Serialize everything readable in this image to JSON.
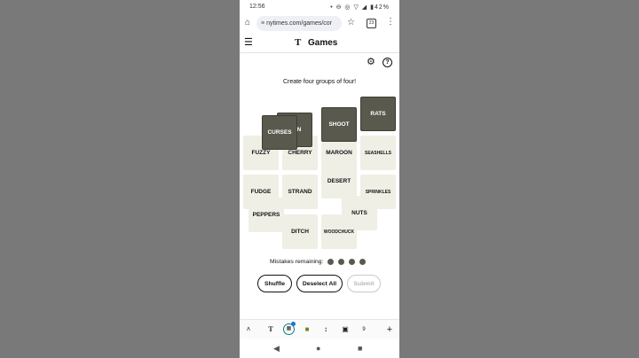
{
  "status": {
    "time": "12:56",
    "icons": "•  ⊖ ◎ ▽ ◢ ▮42%"
  },
  "browser": {
    "url": "nytimes.com/games/cor",
    "tab_count": "23"
  },
  "header": {
    "title": "Games",
    "logo": "T"
  },
  "game": {
    "prompt": "Create four groups of four!",
    "tiles": {
      "curses": "CURSES",
      "n_partial": "N",
      "shoot": "SHOOT",
      "rats": "RATS",
      "fuzzy": "FUZZY",
      "cherry": "CHERRY",
      "maroon": "MAROON",
      "seashells": "SEASHELLS",
      "desert": "DESERT",
      "fudge": "FUDGE",
      "strand": "STRAND",
      "sprinkles": "SPRINKLES",
      "peppers": "PEPPERS",
      "nuts": "NUTS",
      "ditch": "DITCH",
      "woodchuck": "WOODCHUCK"
    },
    "mistakes_label": "Mistakes remaining:",
    "mistakes_remaining": 4,
    "buttons": {
      "shuffle": "Shuffle",
      "deselect": "Deselect All",
      "submit": "Submit"
    }
  },
  "toolbar": {
    "up": "˄",
    "plus": "+",
    "tab9": "9"
  },
  "colors": {
    "selected_tile": "#5a594e",
    "tile": "#efefe6",
    "accent": "#0a7e84"
  }
}
